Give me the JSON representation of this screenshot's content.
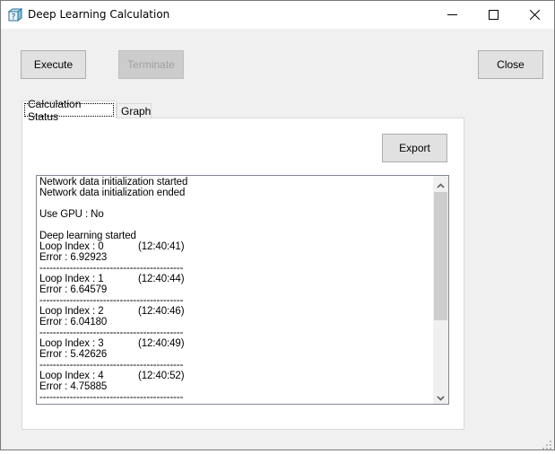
{
  "window": {
    "title": "Deep Learning Calculation",
    "app_icon": "help-cube-icon",
    "controls": {
      "minimize": "minimize-icon",
      "maximize": "maximize-icon",
      "close": "close-icon"
    }
  },
  "toolbar": {
    "execute_label": "Execute",
    "terminate_label": "Terminate",
    "close_label": "Close"
  },
  "tabs": [
    {
      "label": "Calculation Status",
      "active": true
    },
    {
      "label": "Graph",
      "active": false
    }
  ],
  "status_panel": {
    "export_label": "Export",
    "log": [
      "Network data initialization started",
      "Network data initialization ended",
      "",
      "Use GPU : No",
      "",
      "Deep learning started",
      {
        "text": "Loop Index : 0",
        "time": "(12:40:41)"
      },
      "Error : 6.92923",
      "-------------------------------------------",
      {
        "text": "Loop Index : 1",
        "time": "(12:40:44)"
      },
      "Error : 6.64579",
      "-------------------------------------------",
      {
        "text": "Loop Index : 2",
        "time": "(12:40:46)"
      },
      "Error : 6.04180",
      "-------------------------------------------",
      {
        "text": "Loop Index : 3",
        "time": "(12:40:49)"
      },
      "Error : 5.42626",
      "-------------------------------------------",
      {
        "text": "Loop Index : 4",
        "time": "(12:40:52)"
      },
      "Error : 4.75885",
      "-------------------------------------------"
    ],
    "scrollbar": {
      "up": "chevron-up-icon",
      "down": "chevron-down-icon",
      "position_fraction": 0.0
    }
  }
}
